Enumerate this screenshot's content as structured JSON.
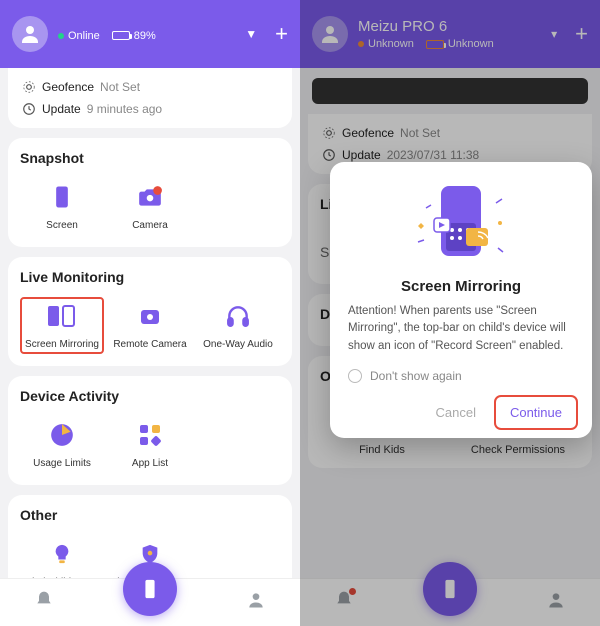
{
  "left": {
    "header": {
      "device_name": "",
      "status_label": "Online",
      "battery_pct": "89%"
    },
    "meta": {
      "geofence_label": "Geofence",
      "geofence_value": "Not Set",
      "update_label": "Update",
      "update_value": "9 minutes ago"
    },
    "snapshot": {
      "title": "Snapshot",
      "items": [
        {
          "label": "Screen"
        },
        {
          "label": "Camera"
        }
      ]
    },
    "live": {
      "title": "Live Monitoring",
      "items": [
        {
          "label": "Screen Mirroring",
          "highlight": true
        },
        {
          "label": "Remote Camera"
        },
        {
          "label": "One-Way Audio"
        }
      ]
    },
    "activity": {
      "title": "Device Activity",
      "items": [
        {
          "label": "Usage Limits"
        },
        {
          "label": "App List"
        }
      ]
    },
    "other": {
      "title": "Other",
      "items": [
        {
          "label": "Find Child's App"
        },
        {
          "label": "Check Permissions"
        }
      ]
    }
  },
  "right": {
    "header": {
      "device_name": "Meizu PRO 6",
      "status_label": "Unknown",
      "battery_label": "Unknown"
    },
    "meta": {
      "geofence_label": "Geofence",
      "geofence_value": "Not Set",
      "update_label": "Update",
      "update_value": "2023/07/31 11:38"
    },
    "bg_items": {
      "find_kids": "Find Kids",
      "check_perms": "Check Permissions"
    },
    "bg_letters": {
      "li": "Li",
      "sc": "Sc",
      "de": "D",
      "ov": "O"
    },
    "modal": {
      "title": "Screen Mirroring",
      "body": "Attention! When parents use \"Screen Mirroring\", the top-bar on child's device will show an icon of \"Record Screen\" enabled.",
      "dont_show": "Don't show again",
      "cancel": "Cancel",
      "continue": "Continue"
    }
  },
  "colors": {
    "accent": "#7b5bea",
    "highlight": "#e74c3c"
  }
}
